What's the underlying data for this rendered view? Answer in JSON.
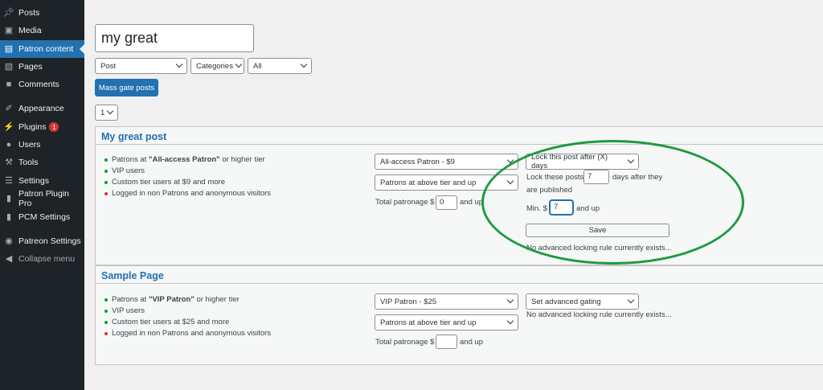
{
  "sidebar": {
    "items": [
      {
        "label": "Posts",
        "icon": "pin-icon"
      },
      {
        "label": "Media",
        "icon": "media-icon"
      },
      {
        "label": "Patron content",
        "icon": "page-icon"
      },
      {
        "label": "Pages",
        "icon": "pages-icon"
      },
      {
        "label": "Comments",
        "icon": "comment-icon"
      },
      {
        "label": "Appearance",
        "icon": "brush-icon"
      },
      {
        "label": "Plugins",
        "icon": "plug-icon",
        "badge": "1"
      },
      {
        "label": "Users",
        "icon": "user-icon"
      },
      {
        "label": "Tools",
        "icon": "wrench-icon"
      },
      {
        "label": "Settings",
        "icon": "sliders-icon"
      },
      {
        "label": "Patron Plugin Pro",
        "icon": "patreon-icon"
      },
      {
        "label": "PCM Settings",
        "icon": "patreon-icon"
      },
      {
        "label": "Patreon Settings",
        "icon": "patreon-circle-icon"
      },
      {
        "label": "Collapse menu",
        "icon": "collapse-icon"
      }
    ]
  },
  "search": {
    "value": "my great"
  },
  "filters": {
    "post_type": "Post",
    "categories": "Categories",
    "all": "All"
  },
  "mass_gate_label": "Mass gate posts",
  "page_select": "1",
  "posts": [
    {
      "title": "My great post",
      "bullets": [
        {
          "prefix": "Patrons at ",
          "bold": "\"All-access Patron\"",
          "suffix": " or higher tier"
        },
        {
          "text": "VIP users"
        },
        {
          "text": "Custom tier users at $9 and more"
        },
        {
          "text": "Logged in non Patrons and anonymous visitors"
        }
      ],
      "tier_select": "All-access Patron - $9",
      "rule_select": "Patrons at above tier and up",
      "total_patronage_label": "Total patronage $",
      "total_patronage_value": "0",
      "and_up": "and up",
      "lock_select": "Lock this post after (X) days",
      "lock_these_posts": "Lock these posts",
      "lock_days_value": "7",
      "days_after": "days after they",
      "are_published": "are published",
      "min_label": "Min. $",
      "min_value": "7",
      "save_label": "Save",
      "no_rule": "No advanced locking rule currently exists..."
    },
    {
      "title": "Sample Page",
      "bullets": [
        {
          "prefix": "Patrons at ",
          "bold": "\"VIP Patron\"",
          "suffix": " or higher tier"
        },
        {
          "text": "VIP users"
        },
        {
          "text": "Custom tier users at $25 and more"
        },
        {
          "text": "Logged in non Patrons and anonymous visitors"
        }
      ],
      "tier_select": "VIP Patron - $25",
      "rule_select": "Patrons at above tier and up",
      "total_patronage_label": "Total patronage $",
      "total_patronage_value": "",
      "and_up": "and up",
      "gating_select": "Set advanced gating",
      "no_rule": "No advanced locking rule currently exists..."
    }
  ],
  "colors": {
    "accent": "#2271b1",
    "sidebar": "#1d2327",
    "highlight_ellipse": "#1e9a3f",
    "bullet_green": "#00a32a",
    "bullet_red": "#d63638"
  }
}
